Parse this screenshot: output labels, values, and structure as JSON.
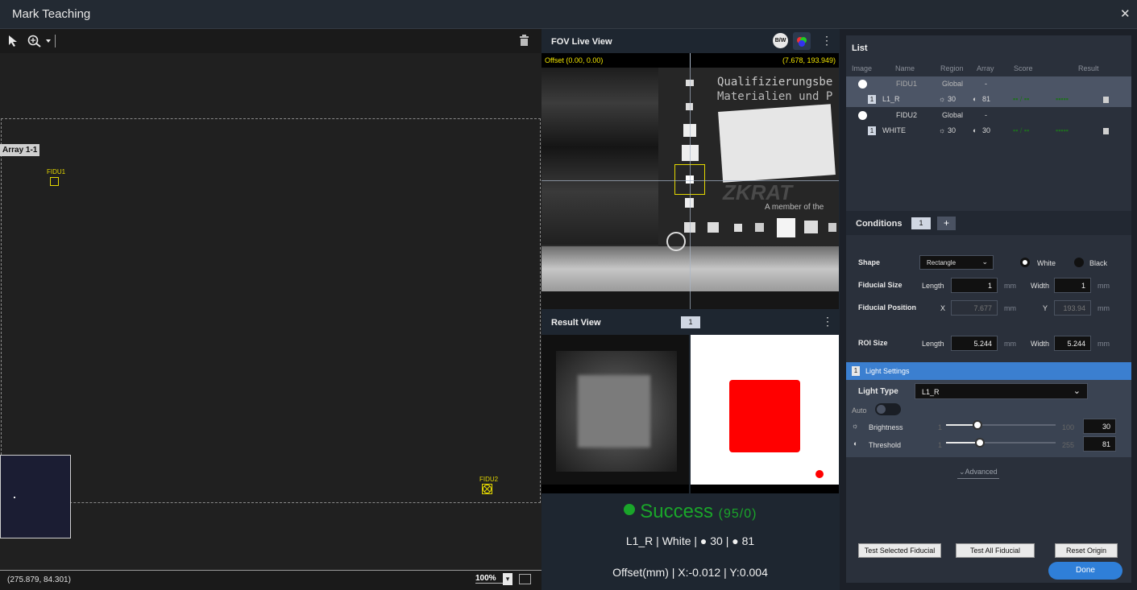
{
  "window": {
    "title": "Mark Teaching",
    "close_glyph": "✕"
  },
  "left": {
    "array_label": "Array 1-1",
    "fiducials": [
      "FIDU1",
      "FIDU2"
    ],
    "status": {
      "coords": "(275.879, 84.301)",
      "zoom": "100%"
    }
  },
  "fov": {
    "title": "FOV Live View",
    "offset_left": "Offset (0.00, 0.00)",
    "offset_right": "(7.678, 193.949)",
    "bw_label": "B/W",
    "image_text": [
      "Qualifizierungsbe",
      "Materialien und P",
      "ZKRAT",
      "A member of the"
    ]
  },
  "result": {
    "title": "Result View",
    "index": "1",
    "status": "Success",
    "status_counts": "(95/0)",
    "status_color": "#1aa52a",
    "summary": "L1_R  |  White  |  ● 30  |  ● 81",
    "offset": "Offset(mm)  |  X:-0.012  |  Y:0.004"
  },
  "list": {
    "title": "List",
    "columns": [
      "Image",
      "Name",
      "Region",
      "Array",
      "Score",
      "Result"
    ],
    "groups": [
      {
        "name": "FIDU1",
        "region": "Global",
        "array": "-",
        "selected": true,
        "child": {
          "idx": "1",
          "name": "L1_R",
          "brightness": "30",
          "threshold": "81"
        }
      },
      {
        "name": "FIDU2",
        "region": "Global",
        "array": "-",
        "selected": false,
        "child": {
          "idx": "1",
          "name": "WHITE",
          "brightness": "30",
          "threshold": "30"
        }
      }
    ]
  },
  "conditions": {
    "title": "Conditions",
    "index": "1",
    "add": "+",
    "shape": {
      "label": "Shape",
      "value": "Rectangle",
      "white": "White",
      "black": "Black"
    },
    "fiducial_size": {
      "label": "Fiducial Size",
      "length_label": "Length",
      "length": "1",
      "width_label": "Width",
      "width": "1",
      "unit": "mm"
    },
    "fiducial_position": {
      "label": "Fiducial Position",
      "x_label": "X",
      "x": "7.677",
      "y_label": "Y",
      "y": "193.94",
      "unit": "mm"
    },
    "roi_size": {
      "label": "ROI Size",
      "length_label": "Length",
      "length": "5.244",
      "width_label": "Width",
      "width": "5.244",
      "unit": "mm"
    }
  },
  "light": {
    "index": "1",
    "title": "Light Settings",
    "type_label": "Light Type",
    "type_value": "L1_R",
    "auto_label": "Auto",
    "brightness": {
      "label": "Brightness",
      "min": "1",
      "max": "100",
      "value": "30",
      "fraction": 0.29
    },
    "threshold": {
      "label": "Threshold",
      "min": "1",
      "max": "255",
      "value": "81",
      "fraction": 0.31
    },
    "advanced": "Advanced"
  },
  "buttons": {
    "test_selected": "Test Selected Fiducial",
    "test_all": "Test All Fiducial",
    "reset_origin": "Reset Origin",
    "done": "Done"
  }
}
